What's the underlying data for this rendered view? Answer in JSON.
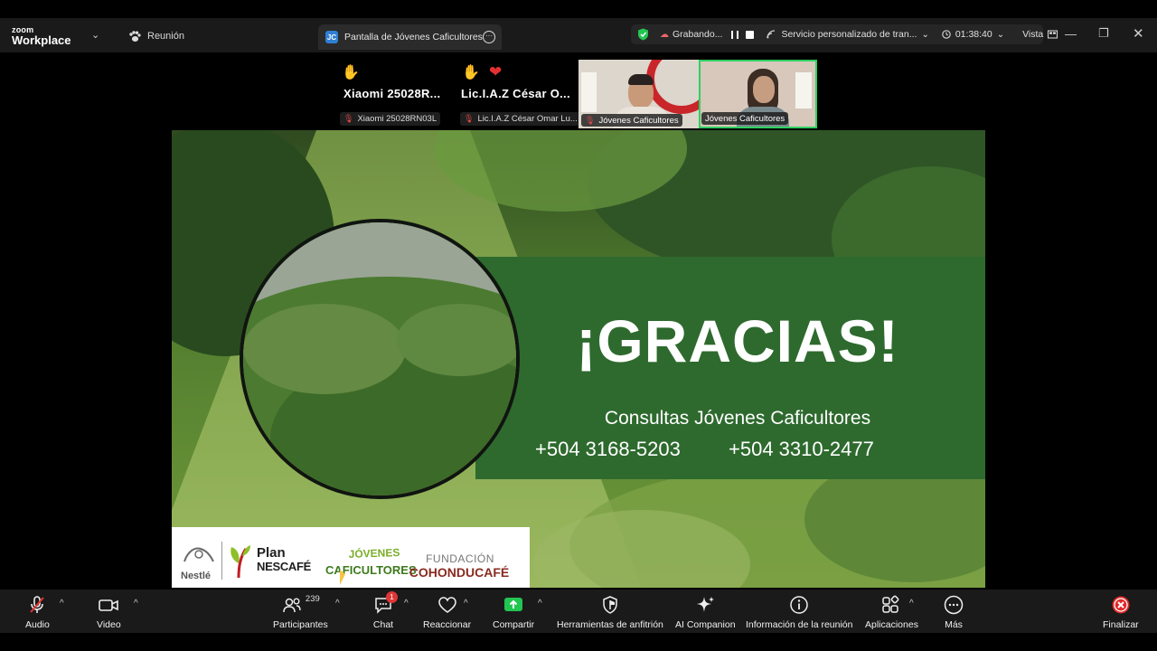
{
  "app": {
    "logo_small": "zoom",
    "logo_big": "Workplace",
    "meeting_label": "Reunión"
  },
  "tab": {
    "icon_text": "JC",
    "title": "Pantalla de Jóvenes Caficultores"
  },
  "status": {
    "recording_label": "Grabando...",
    "transcription_label": "Servicio personalizado de tran...",
    "timer": "01:38:40",
    "view_label": "Vista"
  },
  "participants": [
    {
      "display_name": "Xiaomi 25028R...",
      "tile_label": "Xiaomi 25028RN03L"
    },
    {
      "display_name": "Lic.I.A.Z César O...",
      "tile_label": "Lic.I.A.Z César Omar Lu..."
    }
  ],
  "video_tiles": [
    {
      "label": "Jóvenes Caficultores"
    },
    {
      "label": "Jóvenes Caficultores"
    }
  ],
  "slide": {
    "headline": "¡GRACIAS!",
    "subtitle": "Consultas Jóvenes Caficultores",
    "phone_1": "+504 3168-5203",
    "phone_2": "+504 3310-2477",
    "logos": {
      "nestle": "Nestlé",
      "plan": "Plan",
      "nescafe": "NESCAFÉ",
      "jc_top": "JÓVENES",
      "jc_bottom": "CAFICULTORES",
      "fund_top": "FUNDACIÓN",
      "fund_bottom": "COHONDUCAFÉ"
    }
  },
  "toolbar": {
    "audio": "Audio",
    "video": "Video",
    "participants": "Participantes",
    "participants_count": "239",
    "chat": "Chat",
    "chat_badge": "1",
    "react": "Reaccionar",
    "share": "Compartir",
    "host_tools": "Herramientas de anfitrión",
    "ai": "AI Companion",
    "info": "Información de la reunión",
    "apps": "Aplicaciones",
    "more": "Más",
    "end": "Finalizar"
  },
  "colors": {
    "accent_green": "#23c552",
    "recording_red": "#e04848",
    "slide_green": "#2e6a2e",
    "end_red": "#e02828"
  }
}
